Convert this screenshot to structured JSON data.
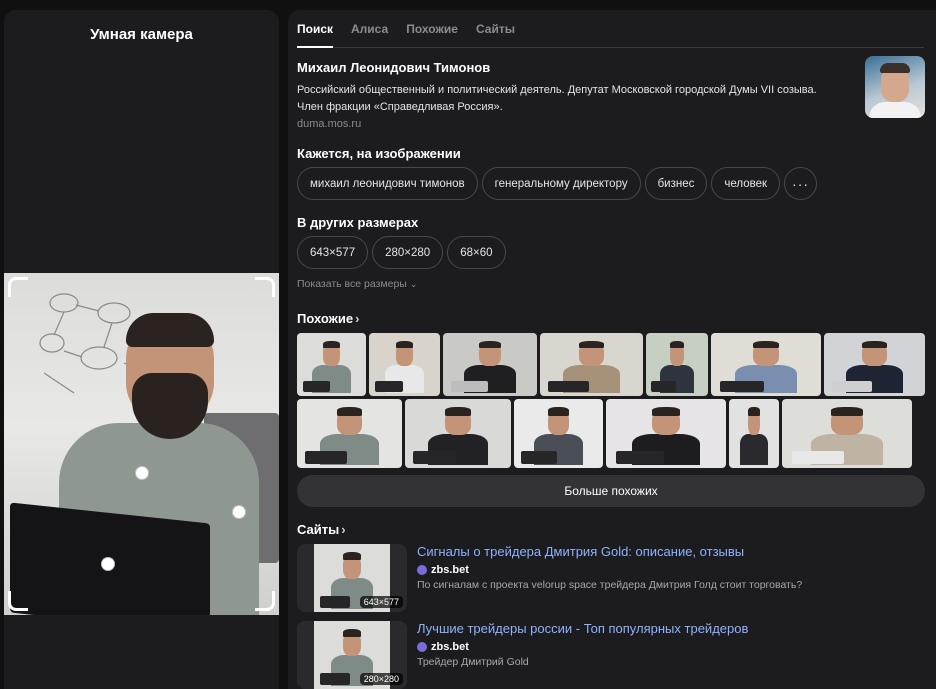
{
  "camera": {
    "title": "Умная камера"
  },
  "tabs": [
    {
      "label": "Поиск",
      "active": true
    },
    {
      "label": "Алиса",
      "active": false
    },
    {
      "label": "Похожие",
      "active": false
    },
    {
      "label": "Сайты",
      "active": false
    }
  ],
  "entity": {
    "name": "Михаил Леонидович Тимонов",
    "description": "Российский общественный и политический деятель. Депутат Московской городской Думы VII созыва. Член фракции «Справедливая Россия».",
    "source": "duma.mos.ru"
  },
  "tags_section": {
    "title": "Кажется, на изображении",
    "tags": [
      "михаил леонидович тимонов",
      "генеральному директору",
      "бизнес",
      "человек"
    ],
    "more_label": "···"
  },
  "sizes_section": {
    "title": "В других размерах",
    "sizes": [
      "643×577",
      "280×280",
      "68×60"
    ],
    "show_all_label": "Показать все размеры"
  },
  "similar_section": {
    "title": "Похожие",
    "more_button": "Больше похожих"
  },
  "sites_section": {
    "title": "Сайты",
    "items": [
      {
        "title": "Сигналы о трейдера Дмитрия Gold: описание, отзывы",
        "domain": "zbs.bet",
        "snippet": "По сигналам с проекта velorup space трейдера Дмитрия Голд стоит торговать?",
        "size": "643×577"
      },
      {
        "title": "Лучшие трейдеры россии - Топ популярных трейдеров",
        "domain": "zbs.bet",
        "snippet": "Трейдер Дмитрий Gold",
        "size": "280×280"
      }
    ]
  },
  "colors": {
    "background": "#101010",
    "panel": "#1c1c1f",
    "link": "#8fb2ff",
    "muted": "#8c8c90"
  }
}
